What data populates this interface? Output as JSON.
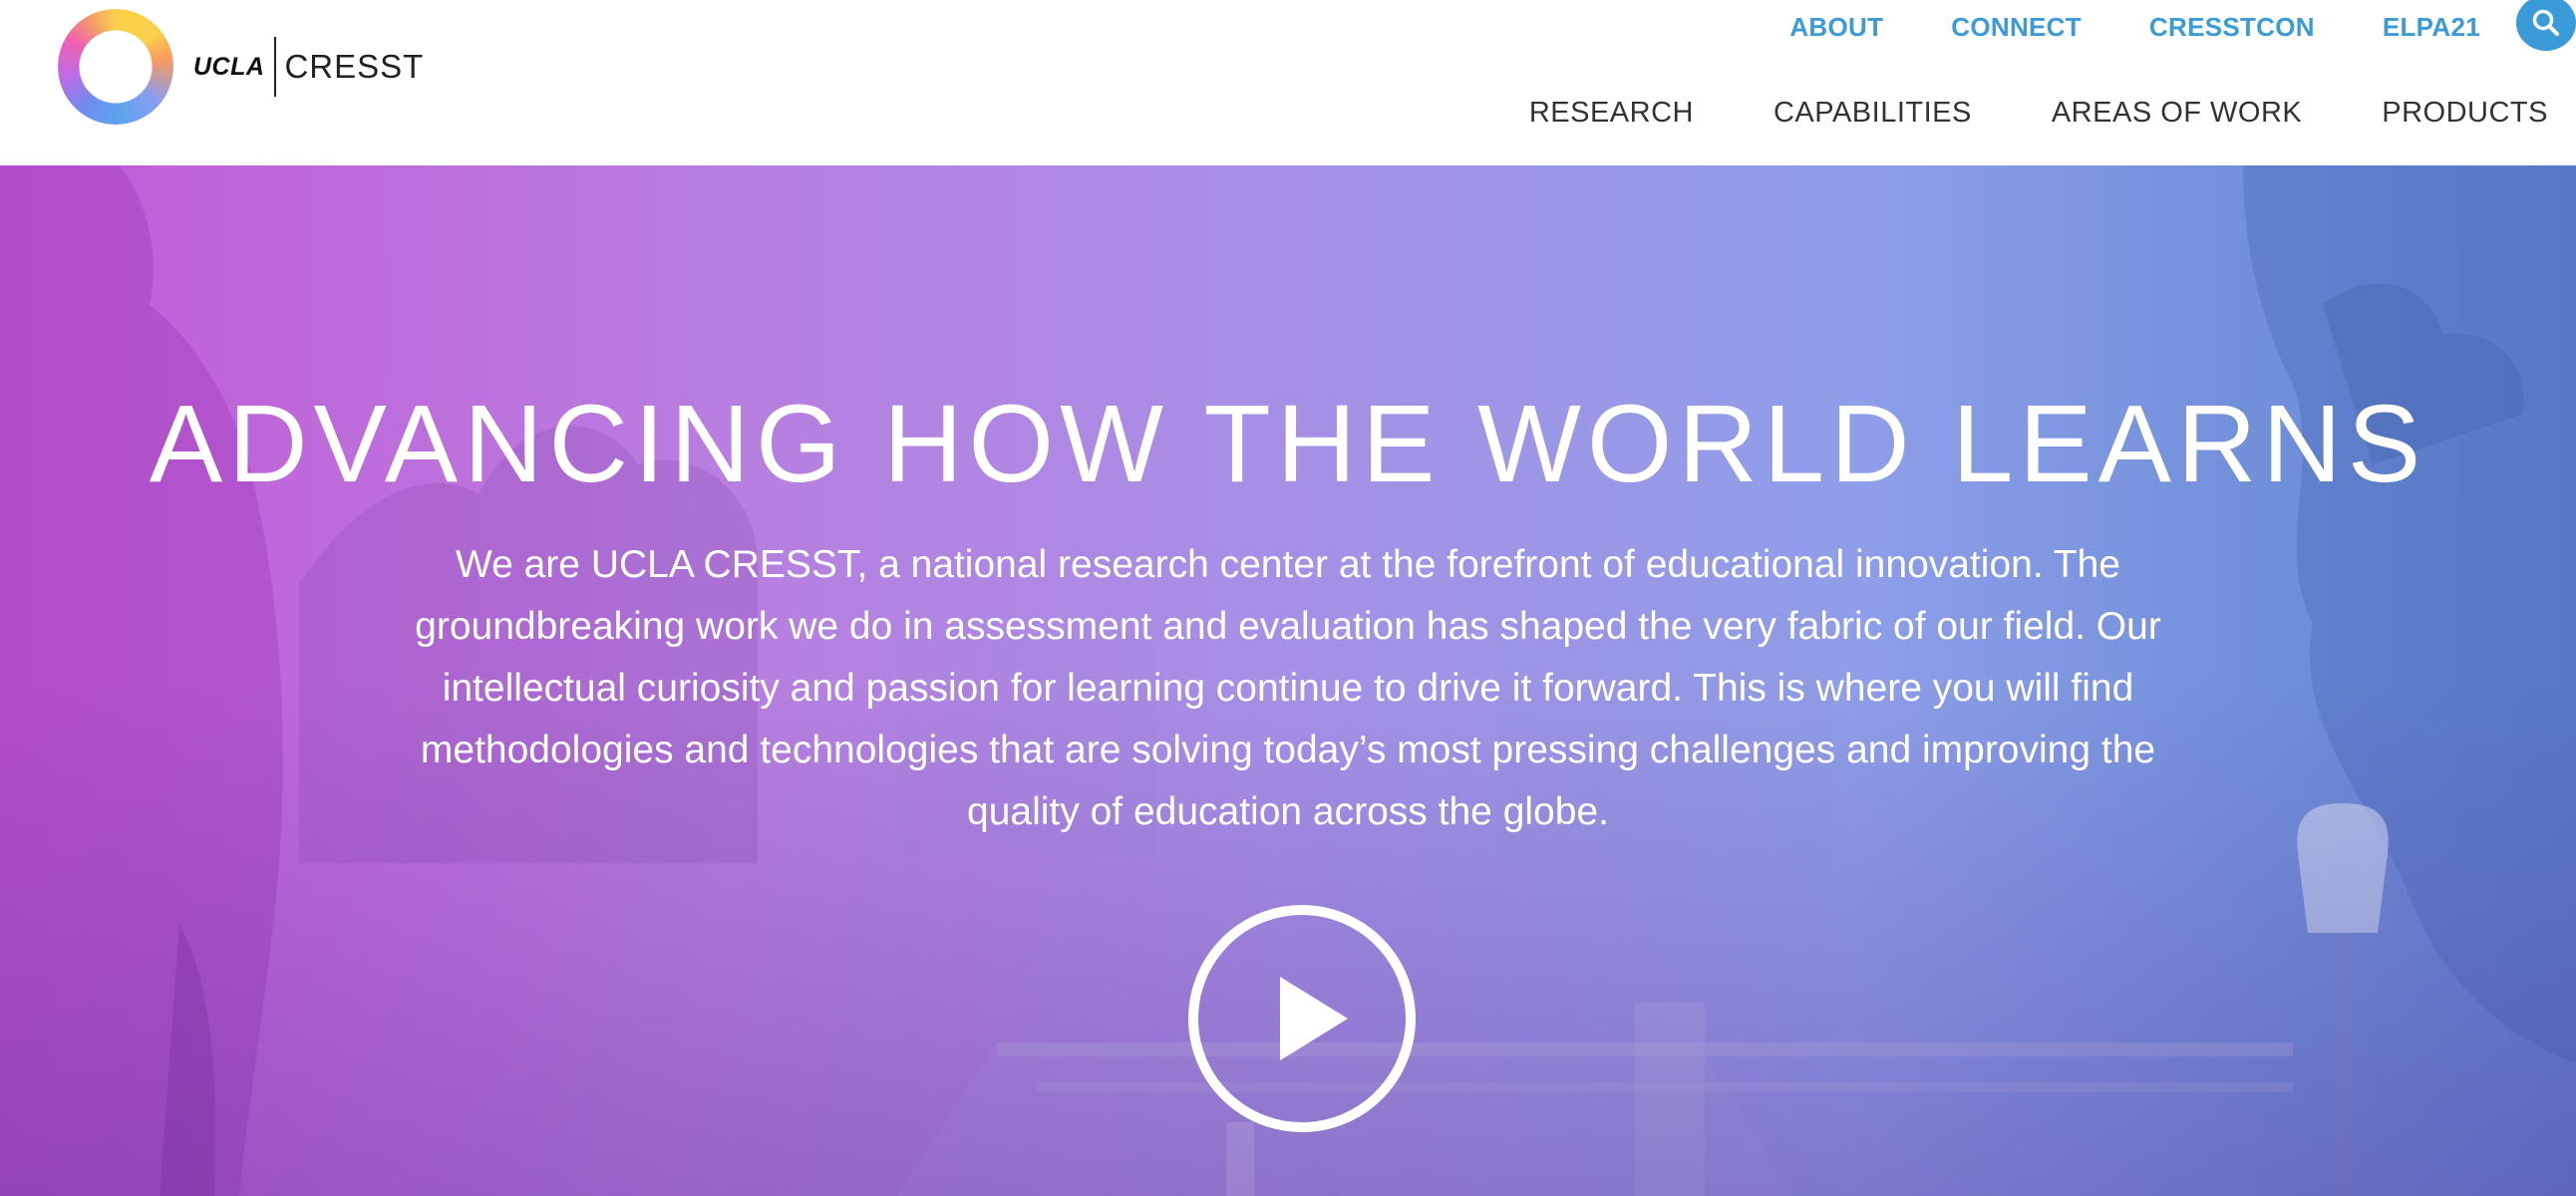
{
  "brand": {
    "ucla": "UCLA",
    "cresst": "CRESST"
  },
  "utility_nav": {
    "items": [
      {
        "label": "ABOUT"
      },
      {
        "label": "CONNECT"
      },
      {
        "label": "CRESSTCON"
      },
      {
        "label": "ELPA21"
      }
    ],
    "search_icon": "search-icon"
  },
  "main_nav": {
    "items": [
      {
        "label": "RESEARCH"
      },
      {
        "label": "CAPABILITIES"
      },
      {
        "label": "AREAS OF WORK"
      },
      {
        "label": "PRODUCTS"
      }
    ]
  },
  "hero": {
    "title": "ADVANCING HOW THE WORLD LEARNS",
    "intro": "We are UCLA CRESST, a national research center at the forefront of educational innovation. The groundbreaking work we do in assessment and evaluation has shaped the very fabric of our field. Our intellectual curiosity and passion for learning continue to drive it forward. This is where you will find methodologies and technologies that are solving today’s most pressing challenges and improving the quality of education across the globe.",
    "play_icon": "play-icon"
  },
  "colors": {
    "accent_blue": "#3b9ad8",
    "nav_text": "#333333",
    "hero_left": "#c25ad6",
    "hero_right": "#5f82cf"
  }
}
